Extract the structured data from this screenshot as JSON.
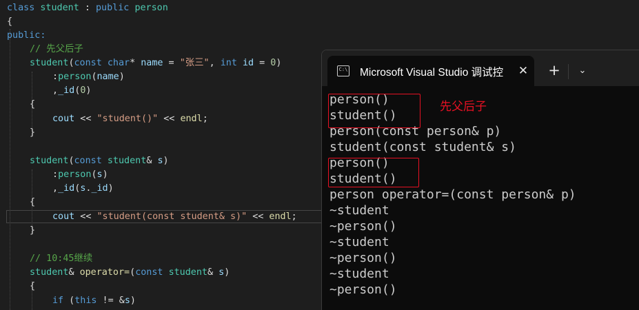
{
  "editor": {
    "lines": [
      [
        "class student : public person"
      ],
      [
        "{"
      ],
      [
        "public:"
      ],
      [
        "// 先父后子"
      ],
      [
        "student(const char* name = \"张三\", int id = 0)"
      ],
      [
        ":person(name)"
      ],
      [
        ",_id(0)"
      ],
      [
        "{"
      ],
      [
        "cout << \"student()\" << endl;"
      ],
      [
        "}"
      ],
      [
        ""
      ],
      [
        "student(const student& s)"
      ],
      [
        ":person(s)"
      ],
      [
        ",_id(s._id)"
      ],
      [
        "{"
      ],
      [
        "cout << \"student(const student& s)\" << endl;"
      ],
      [
        "}"
      ],
      [
        ""
      ],
      [
        "// 10:45继续"
      ],
      [
        "student& operator=(const student& s)"
      ],
      [
        "{"
      ],
      [
        "if (this != &s)"
      ]
    ],
    "tokens": {
      "l0": [
        "class",
        "student",
        ":",
        "public",
        "person"
      ],
      "l3": "// 先父后子",
      "l18": "// 10:45继续"
    }
  },
  "terminal": {
    "tab_icon": "C:\\",
    "tab_title": "Microsoft Visual Studio 调试控",
    "close_icon": "✕",
    "new_tab_icon": "+",
    "dropdown_icon": "⌄",
    "output": [
      "person()",
      "student()",
      "person(const person& p)",
      "student(const student& s)",
      "person()",
      "student()",
      "person operator=(const person& p)",
      "~student",
      "~person()",
      "~student",
      "~person()",
      "~student",
      "~person()"
    ],
    "annotation": "先父后子",
    "annotation_color": "#e81123"
  }
}
